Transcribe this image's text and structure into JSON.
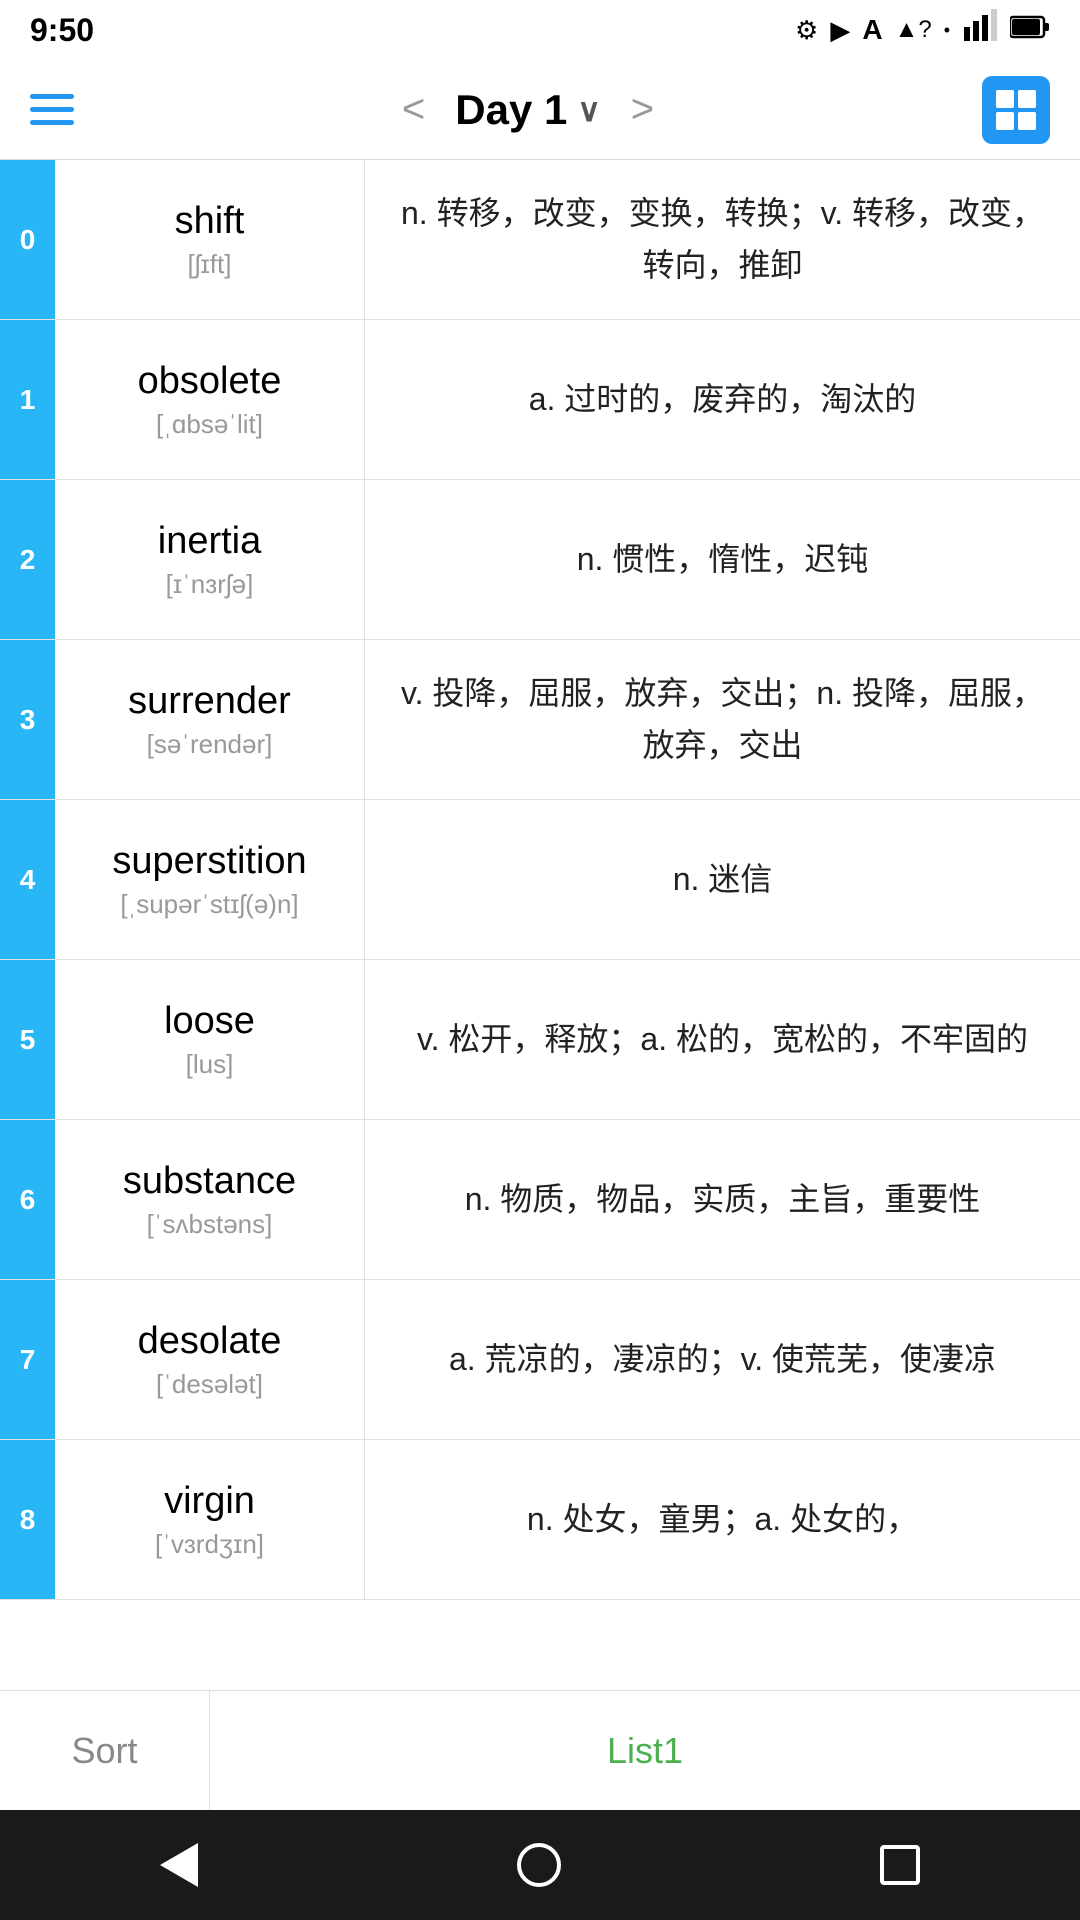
{
  "statusBar": {
    "time": "9:50",
    "icons": [
      "gear",
      "play",
      "text",
      "wifi",
      "dot"
    ]
  },
  "topNav": {
    "prevLabel": "<",
    "nextLabel": ">",
    "title": "Day 1",
    "dropdownArrow": "∨"
  },
  "words": [
    {
      "index": "0",
      "word": "shift",
      "phonetic": "[ʃɪft]",
      "definition": "n. 转移，改变，变换，转换；v. 转移，改变，转向，推卸"
    },
    {
      "index": "1",
      "word": "obsolete",
      "phonetic": "[ˌɑbsəˈlit]",
      "definition": "a. 过时的，废弃的，淘汰的"
    },
    {
      "index": "2",
      "word": "inertia",
      "phonetic": "[ɪˈnɜrʃə]",
      "definition": "n. 惯性，惰性，迟钝"
    },
    {
      "index": "3",
      "word": "surrender",
      "phonetic": "[səˈrendər]",
      "definition": "v. 投降，屈服，放弃，交出；n. 投降，屈服，放弃，交出"
    },
    {
      "index": "4",
      "word": "superstition",
      "phonetic": "[ˌsupərˈstɪʃ(ə)n]",
      "definition": "n. 迷信"
    },
    {
      "index": "5",
      "word": "loose",
      "phonetic": "[lus]",
      "definition": "v. 松开，释放；a. 松的，宽松的，不牢固的"
    },
    {
      "index": "6",
      "word": "substance",
      "phonetic": "[ˈsʌbstəns]",
      "definition": "n. 物质，物品，实质，主旨，重要性"
    },
    {
      "index": "7",
      "word": "desolate",
      "phonetic": "[ˈdesələt]",
      "definition": "a. 荒凉的，凄凉的；v. 使荒芜，使凄凉"
    },
    {
      "index": "8",
      "word": "virgin",
      "phonetic": "[ˈvɜrdʒɪn]",
      "definition": "n. 处女，童男；a. 处女的，"
    }
  ],
  "bottomTabs": {
    "sortLabel": "Sort",
    "list1Label": "List1"
  }
}
